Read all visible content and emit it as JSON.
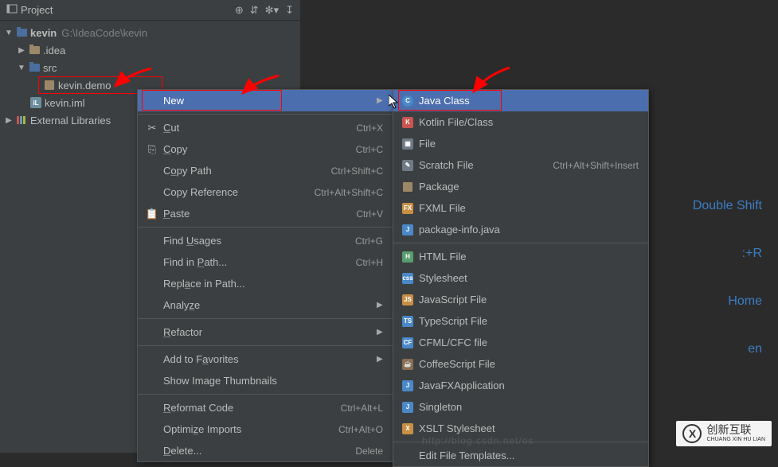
{
  "panel": {
    "title": "Project"
  },
  "tree": {
    "root": {
      "name": "kevin",
      "path": "G:\\IdeaCode\\kevin"
    },
    "idea": ".idea",
    "src": "src",
    "demo": "kevin.demo",
    "iml": "kevin.iml",
    "external": "External Libraries"
  },
  "ctx": {
    "new": "New",
    "cut": "Cut",
    "cut_sc": "Ctrl+X",
    "copy": "Copy",
    "copy_sc": "Ctrl+C",
    "copy_path": "Copy Path",
    "copy_path_sc": "Ctrl+Shift+C",
    "copy_ref": "Copy Reference",
    "copy_ref_sc": "Ctrl+Alt+Shift+C",
    "paste": "Paste",
    "paste_sc": "Ctrl+V",
    "find_usages": "Find Usages",
    "find_usages_sc": "Ctrl+G",
    "find_in_path": "Find in Path...",
    "find_in_path_sc": "Ctrl+H",
    "replace_in_path": "Replace in Path...",
    "analyze": "Analyze",
    "refactor": "Refactor",
    "add_fav": "Add to Favorites",
    "show_thumb": "Show Image Thumbnails",
    "reformat": "Reformat Code",
    "reformat_sc": "Ctrl+Alt+L",
    "optimize": "Optimize Imports",
    "optimize_sc": "Ctrl+Alt+O",
    "delete": "Delete...",
    "delete_sc": "Delete"
  },
  "newmenu": {
    "java_class": "Java Class",
    "kotlin": "Kotlin File/Class",
    "file": "File",
    "scratch": "Scratch File",
    "scratch_sc": "Ctrl+Alt+Shift+Insert",
    "package": "Package",
    "fxml": "FXML File",
    "pkginfo": "package-info.java",
    "html": "HTML File",
    "stylesheet": "Stylesheet",
    "js": "JavaScript File",
    "ts": "TypeScript File",
    "cfml": "CFML/CFC file",
    "coffee": "CoffeeScript File",
    "javafx": "JavaFXApplication",
    "singleton": "Singleton",
    "xslt": "XSLT Stylesheet",
    "edit_tmpl": "Edit File Templates..."
  },
  "hints": {
    "search": "Double Shift",
    "recent": ":+R",
    "home": "Home",
    "open": "en"
  },
  "watermark": {
    "text1": "创新互联",
    "text2": "CHUANG XIN HU LIAN",
    "logo": "X"
  },
  "url": "http://blog.csdn.net/os"
}
